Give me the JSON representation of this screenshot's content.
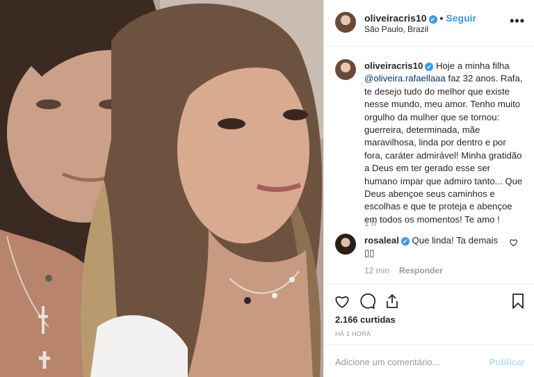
{
  "post": {
    "author": "oliveiracris10",
    "verified_mark": "✔",
    "separator": "•",
    "follow_label": "Seguir",
    "location": "São Paulo, Brazil",
    "more_label": "•••"
  },
  "caption": {
    "author": "oliveiracris10",
    "text_before": " Hoje a minha filha ",
    "mention": "@oliveira.rafaellaaa",
    "text_after": " faz 32 anos. Rafa, te desejo tudo do melhor que existe nesse mundo, meu amor. Tenho muito orgulho da mulher que se tornou: guerreira, determinada, mãe maravilhosa, linda por dentro e por fora, caráter admirável! Minha gratidão a Deus em ter gerado esse ser humano ímpar que admiro tanto... Que Deus abençoe seus caminhos e escolhas e que te proteja e abençoe em todos os momentos! Te amo !",
    "age": "1 h"
  },
  "comment": {
    "author": "rosaleal",
    "text": " Que linda! Ta demais ▯▯",
    "age": "12 min",
    "reply_label": "Responder"
  },
  "actions": {
    "icons": [
      "heart-icon",
      "comment-icon",
      "share-icon",
      "bookmark-icon"
    ],
    "likes": "2.166 curtidas",
    "timestamp": "HÁ 1 HORA"
  },
  "add_comment": {
    "placeholder": "Adicione um comentário...",
    "publish_label": "Publicar"
  },
  "colors": {
    "link_blue": "#3897f0",
    "mention": "#003569",
    "muted": "#999999",
    "publish_disabled": "#b2dffc"
  }
}
